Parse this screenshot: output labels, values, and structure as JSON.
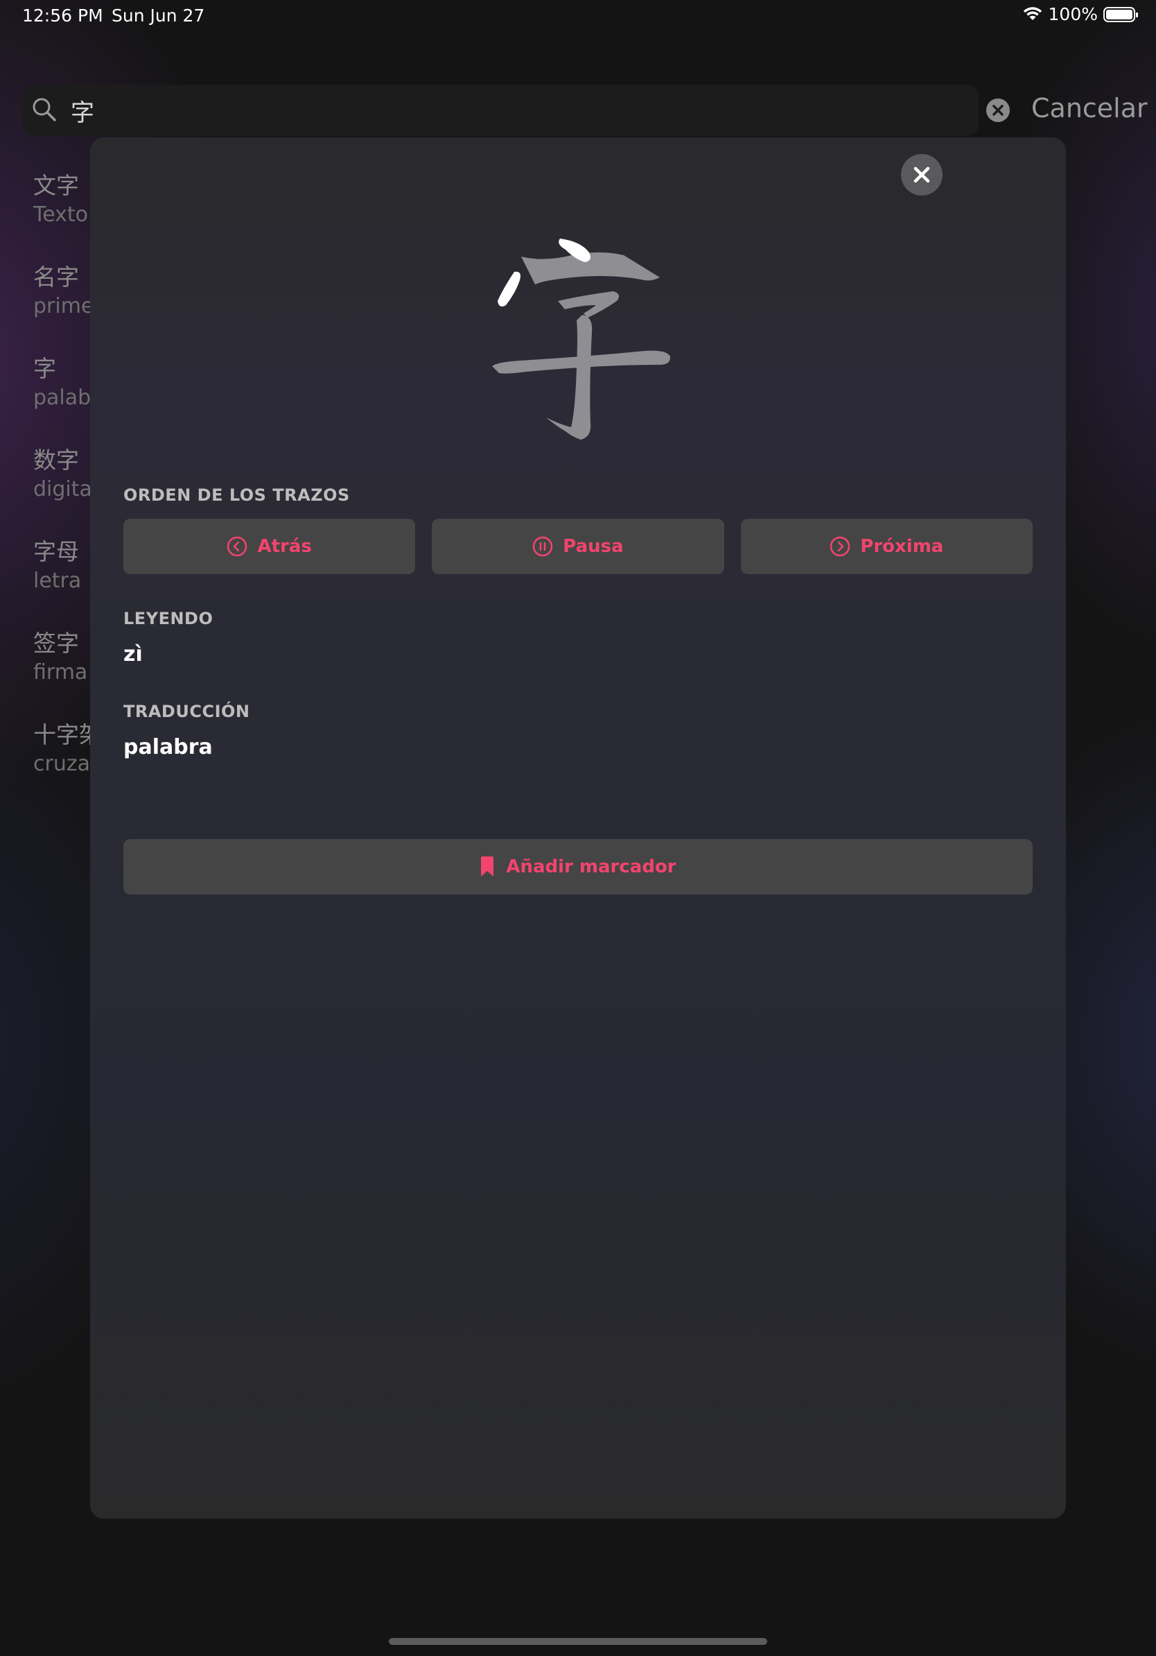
{
  "status_bar": {
    "time": "12:56 PM",
    "date": "Sun Jun 27",
    "battery": "100%"
  },
  "search": {
    "query": "字",
    "cancel_label": "Cancelar"
  },
  "results": [
    {
      "hanzi": "文字",
      "meaning": "Texto"
    },
    {
      "hanzi": "名字",
      "meaning": "primer"
    },
    {
      "hanzi": "字",
      "meaning": "palabr"
    },
    {
      "hanzi": "数字",
      "meaning": "digital"
    },
    {
      "hanzi": "字母",
      "meaning": "letra"
    },
    {
      "hanzi": "签字",
      "meaning": "firma"
    },
    {
      "hanzi": "十字架",
      "meaning": "cruzar"
    }
  ],
  "detail": {
    "character": "字",
    "stroke_order_label": "ORDEN DE LOS TRAZOS",
    "back_label": "Atrás",
    "pause_label": "Pausa",
    "next_label": "Próxima",
    "reading_label": "LEYENDO",
    "reading_value": "zì",
    "translation_label": "TRADUCCIÓN",
    "translation_value": "palabra",
    "bookmark_label": "Añadir marcador"
  },
  "colors": {
    "accent": "#f2446e",
    "modal_bg": "#2a2a2c",
    "button_bg": "#454545",
    "glyph_gray": "#8e8e93",
    "glyph_active": "#ffffff"
  },
  "icons": {
    "search": "search-icon",
    "clear": "clear-icon",
    "close": "close-icon",
    "back": "chevron-left-circle-icon",
    "pause": "pause-circle-icon",
    "next": "chevron-right-circle-icon",
    "bookmark": "bookmark-icon",
    "wifi": "wifi-icon",
    "battery": "battery-icon"
  }
}
